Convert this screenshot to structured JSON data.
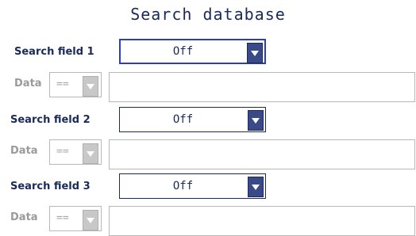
{
  "title": "Search database",
  "search_fields": [
    {
      "label": "Search field 1",
      "value": "Off",
      "data_label": "Data",
      "operator": "==",
      "data_value": ""
    },
    {
      "label": "Search field 2",
      "value": "Off",
      "data_label": "Data",
      "operator": "==",
      "data_value": ""
    },
    {
      "label": "Search field 3",
      "value": "Off",
      "data_label": "Data",
      "operator": "==",
      "data_value": ""
    }
  ],
  "icons": {
    "dropdown": "chevron-down-icon"
  },
  "colors": {
    "text": "#1a2a5a",
    "focus_border": "#2a3cc8",
    "disabled": "#9a9a9a"
  }
}
